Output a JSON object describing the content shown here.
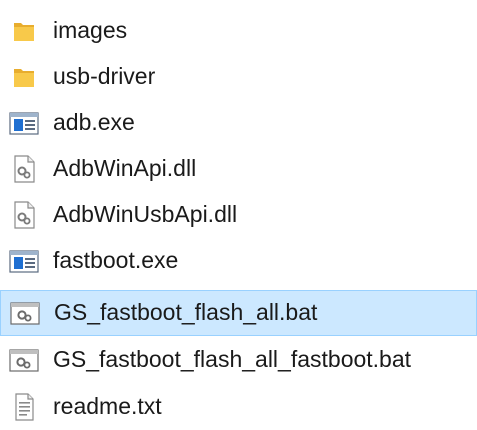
{
  "files": [
    {
      "name": "images",
      "icon": "folder-icon",
      "selected": false
    },
    {
      "name": "usb-driver",
      "icon": "folder-icon",
      "selected": false
    },
    {
      "name": "adb.exe",
      "icon": "application-icon",
      "selected": false
    },
    {
      "name": "AdbWinApi.dll",
      "icon": "gear-file-icon",
      "selected": false
    },
    {
      "name": "AdbWinUsbApi.dll",
      "icon": "gear-file-icon",
      "selected": false
    },
    {
      "name": "fastboot.exe",
      "icon": "application-icon",
      "selected": false
    },
    {
      "name": "GS_fastboot_flash_all.bat",
      "icon": "batch-file-icon",
      "selected": true
    },
    {
      "name": "GS_fastboot_flash_all_fastboot.bat",
      "icon": "batch-file-icon",
      "selected": false
    },
    {
      "name": "readme.txt",
      "icon": "text-file-icon",
      "selected": false
    }
  ],
  "colors": {
    "selection_background": "#cce8ff",
    "selection_border": "#99d1ff",
    "folder": "#f8c94a",
    "application_blue": "#1f6fd1"
  }
}
